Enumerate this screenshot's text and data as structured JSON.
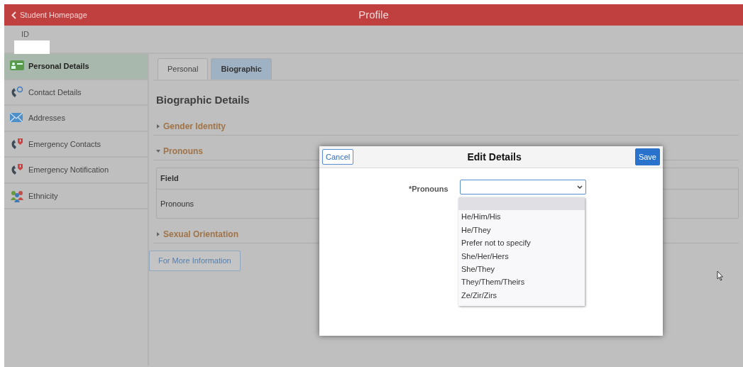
{
  "header": {
    "back_link": "Student Homepage",
    "title": "Profile"
  },
  "id_label": "ID",
  "sidebar": {
    "items": [
      {
        "label": "Personal Details",
        "kind": "card",
        "selected": true
      },
      {
        "label": "Contact Details",
        "kind": "phone-at",
        "selected": false
      },
      {
        "label": "Addresses",
        "kind": "envelope",
        "selected": false
      },
      {
        "label": "Emergency Contacts",
        "kind": "phone-alert",
        "selected": false
      },
      {
        "label": "Emergency Notification",
        "kind": "phone-alert",
        "selected": false
      },
      {
        "label": "Ethnicity",
        "kind": "people",
        "selected": false
      }
    ]
  },
  "tabs": [
    {
      "label": "Personal",
      "selected": false
    },
    {
      "label": "Biographic",
      "selected": true
    }
  ],
  "heading": "Biographic Details",
  "sections": [
    {
      "label": "Gender Identity",
      "expanded": false
    },
    {
      "label": "Pronouns",
      "expanded": true,
      "table": {
        "columns": [
          "Field"
        ],
        "rows": [
          [
            "Pronouns"
          ]
        ]
      }
    },
    {
      "label": "Sexual Orientation",
      "expanded": false
    }
  ],
  "more_info_button": "For More Information",
  "modal": {
    "title": "Edit Details",
    "cancel": "Cancel",
    "save": "Save",
    "field_label": "*Pronouns",
    "dropdown": {
      "open": true,
      "blank_option_highlighted": true,
      "options": [
        {
          "label": "He/Him/His",
          "selected": false
        },
        {
          "label": "He/They",
          "selected": false
        },
        {
          "label": "Prefer not to specify",
          "selected": false
        },
        {
          "label": "She/Her/Hers",
          "selected": false
        },
        {
          "label": "She/They",
          "selected": false
        },
        {
          "label": "They/Them/Theirs",
          "selected": false
        },
        {
          "label": "Ze/Zir/Zirs",
          "selected": false
        }
      ]
    }
  }
}
